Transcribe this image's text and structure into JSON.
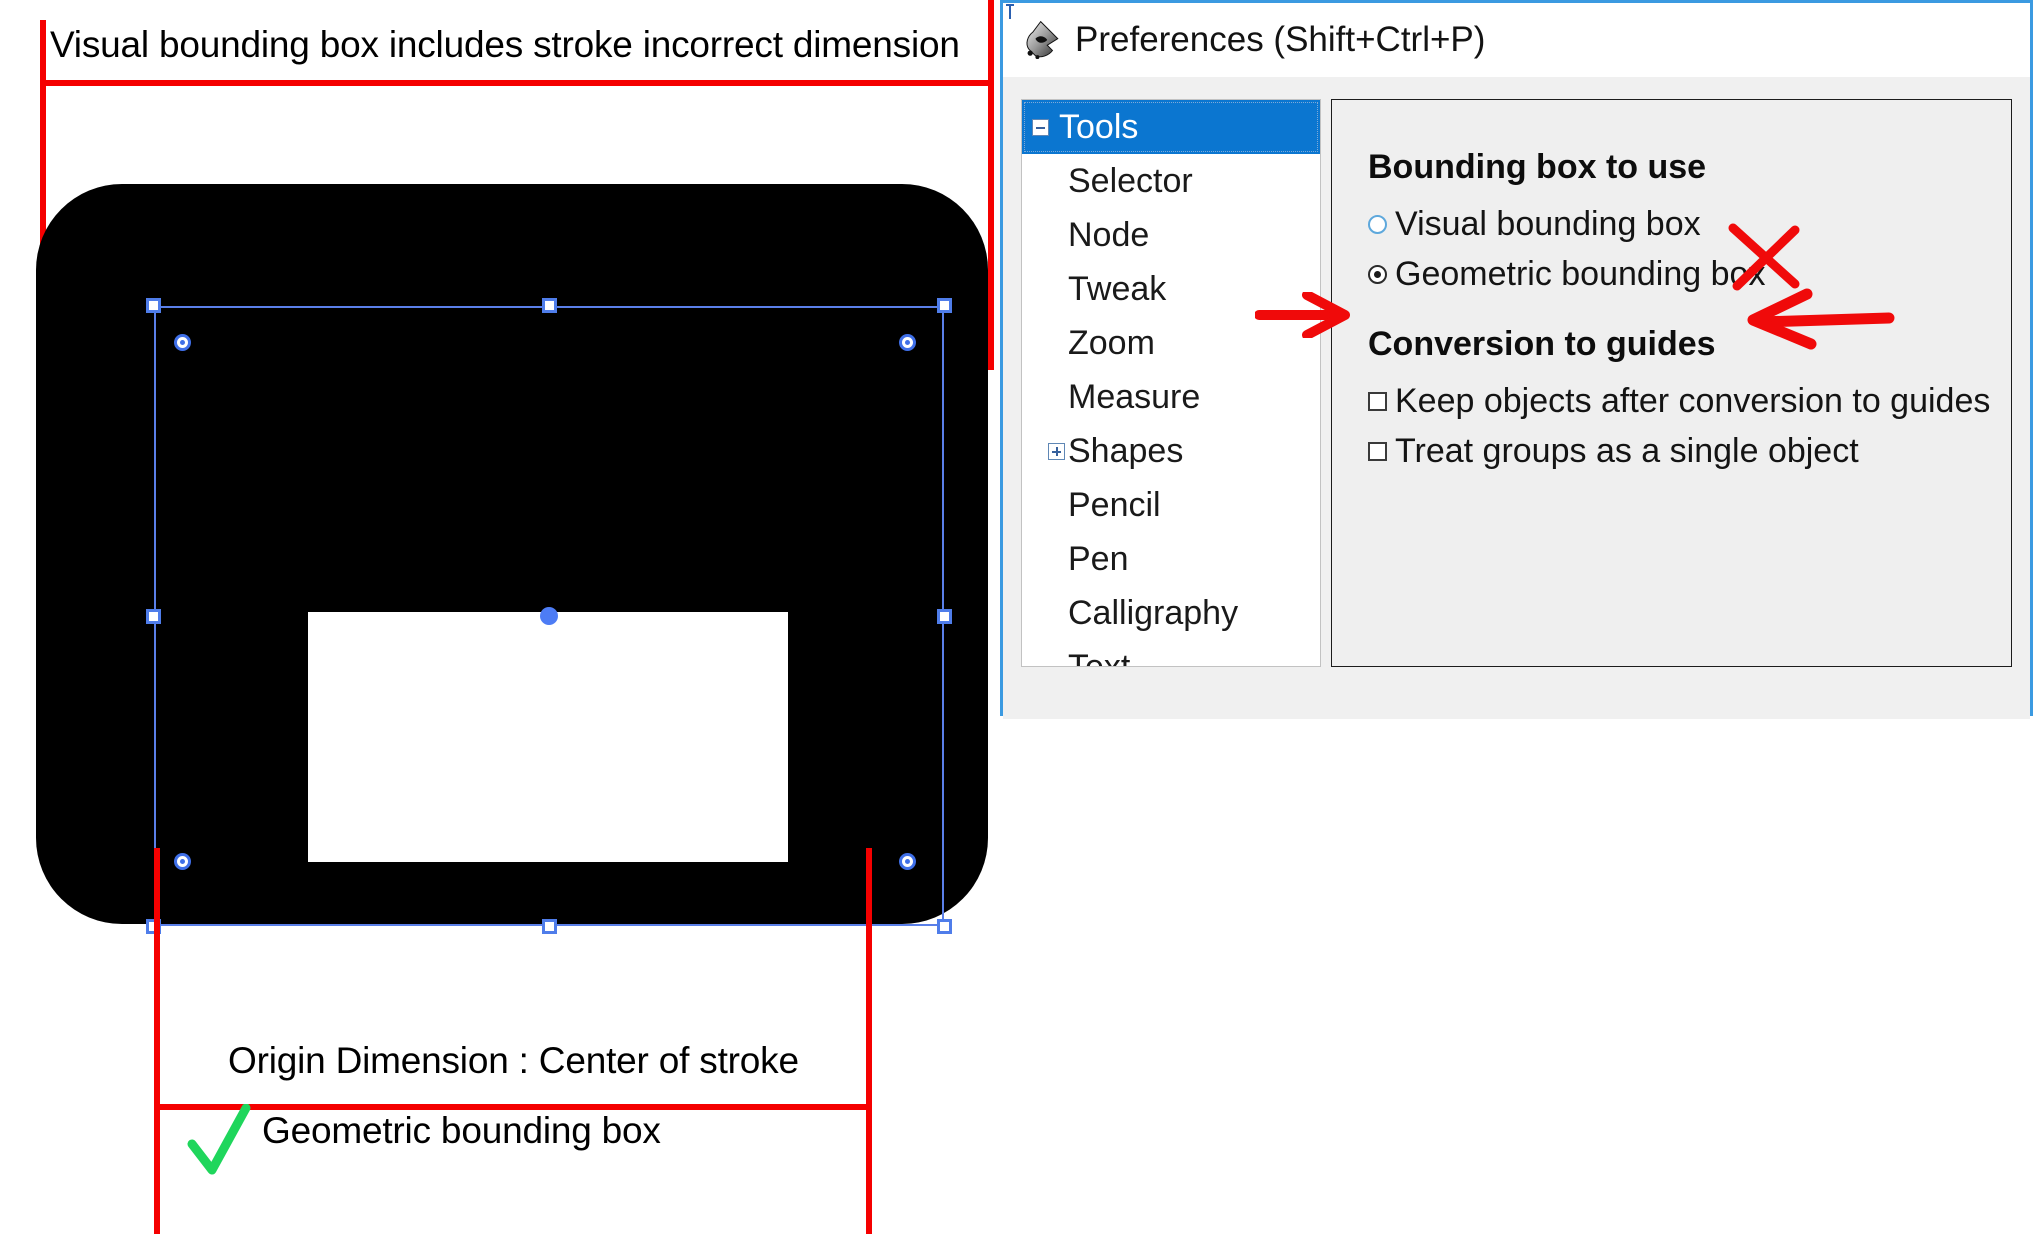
{
  "annotations": {
    "top_text": "Visual bounding box  includes stroke incorrect dimension",
    "origin_text": "Origin Dimension :  Center of stroke",
    "geometric_text": "Geometric bounding box",
    "check_icon": "green-check-icon",
    "x_icon": "red-x-icon",
    "arrow_left_icon": "red-arrow-right-icon",
    "arrow_right_icon": "red-arrow-left-icon",
    "colors": {
      "guide_red": "#f50000",
      "check_green": "#1fd65c",
      "selection_blue": "#4f7dea",
      "accent_blue": "#0b76d0"
    }
  },
  "artwork": {
    "shape_fill": "#000000",
    "hole_fill": "#ffffff",
    "handle_fill": "#ffffff",
    "handle_stroke": "#4f7dea",
    "center_dot": "#4d7cf5"
  },
  "prefs": {
    "title": "Preferences (Shift+Ctrl+P)",
    "logo_icon": "inkscape-logo-icon",
    "tree": {
      "root": {
        "label": "Tools",
        "expander": "minus",
        "selected": true
      },
      "items": [
        {
          "label": "Selector",
          "expander": null
        },
        {
          "label": "Node",
          "expander": null
        },
        {
          "label": "Tweak",
          "expander": null
        },
        {
          "label": "Zoom",
          "expander": null
        },
        {
          "label": "Measure",
          "expander": null
        },
        {
          "label": "Shapes",
          "expander": "plus"
        },
        {
          "label": "Pencil",
          "expander": null
        },
        {
          "label": "Pen",
          "expander": null
        },
        {
          "label": "Calligraphy",
          "expander": null
        },
        {
          "label": "Text",
          "expander": null
        }
      ]
    },
    "settings": {
      "group1_title": "Bounding box to use",
      "radio_visual": "Visual bounding box",
      "radio_geometric": "Geometric bounding box",
      "group2_title": "Conversion to guides",
      "check_keep": "Keep objects after conversion to guides",
      "check_treat": "Treat groups as a single object"
    }
  }
}
